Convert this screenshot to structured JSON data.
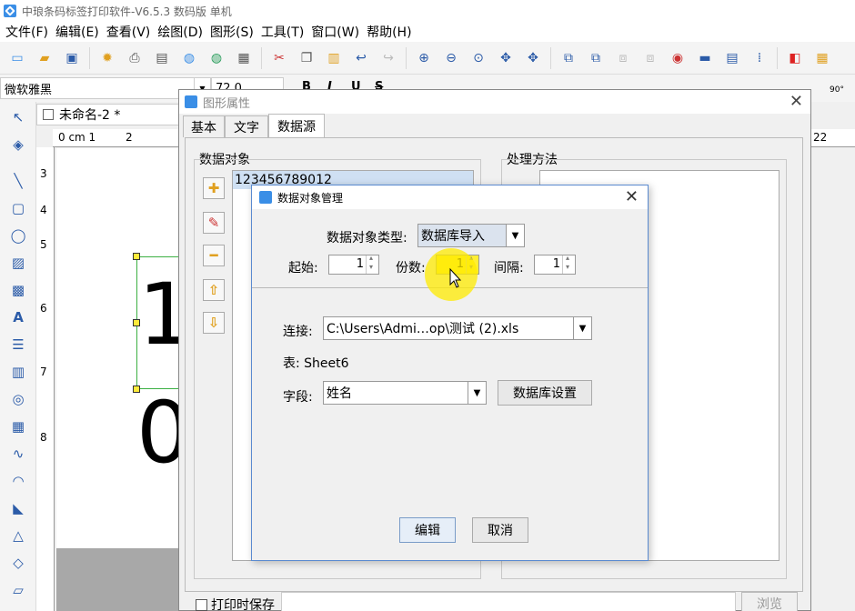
{
  "app": {
    "title": "中琅条码标签打印软件-V6.5.3 数码版 单机"
  },
  "menu": [
    "文件(F)",
    "编辑(E)",
    "查看(V)",
    "绘图(D)",
    "图形(S)",
    "工具(T)",
    "窗口(W)",
    "帮助(H)"
  ],
  "format": {
    "font": "微软雅黑",
    "size": "72.0",
    "bold": "B",
    "italic": "I",
    "underline": "U",
    "strike": "S",
    "rotate": "90°"
  },
  "document": {
    "tab": "未命名-2 *",
    "ruler_h_start": "0 cm 1",
    "ruler_h_2": "2",
    "ruler_h_end": "22",
    "ruler_v": [
      "3",
      "4",
      "5",
      "6",
      "7",
      "8"
    ],
    "digit_top": "1",
    "digit_bottom": "0"
  },
  "props": {
    "title": "图形属性",
    "tabs": [
      "基本",
      "文字",
      "数据源"
    ],
    "data_object_label": "数据对象",
    "method_label": "处理方法",
    "data_objects": [
      "123456789012"
    ],
    "print_save_label": "打印时保存",
    "browse": "浏览"
  },
  "dom": {
    "title": "数据对象管理",
    "type_label": "数据对象类型:",
    "type_value": "数据库导入",
    "start_label": "起始:",
    "start_value": "1",
    "copies_label": "份数:",
    "copies_value": "1",
    "interval_label": "间隔:",
    "interval_value": "1",
    "connect_label": "连接:",
    "connect_value": "C:\\Users\\Admi…op\\测试 (2).xls",
    "table_label": "表: Sheet6",
    "field_label": "字段:",
    "field_value": "姓名",
    "db_settings": "数据库设置",
    "edit": "编辑",
    "cancel": "取消"
  },
  "colors": {
    "accent": "#3a8ee6",
    "highlight": "#ffeb00",
    "selection": "#3cb043"
  }
}
